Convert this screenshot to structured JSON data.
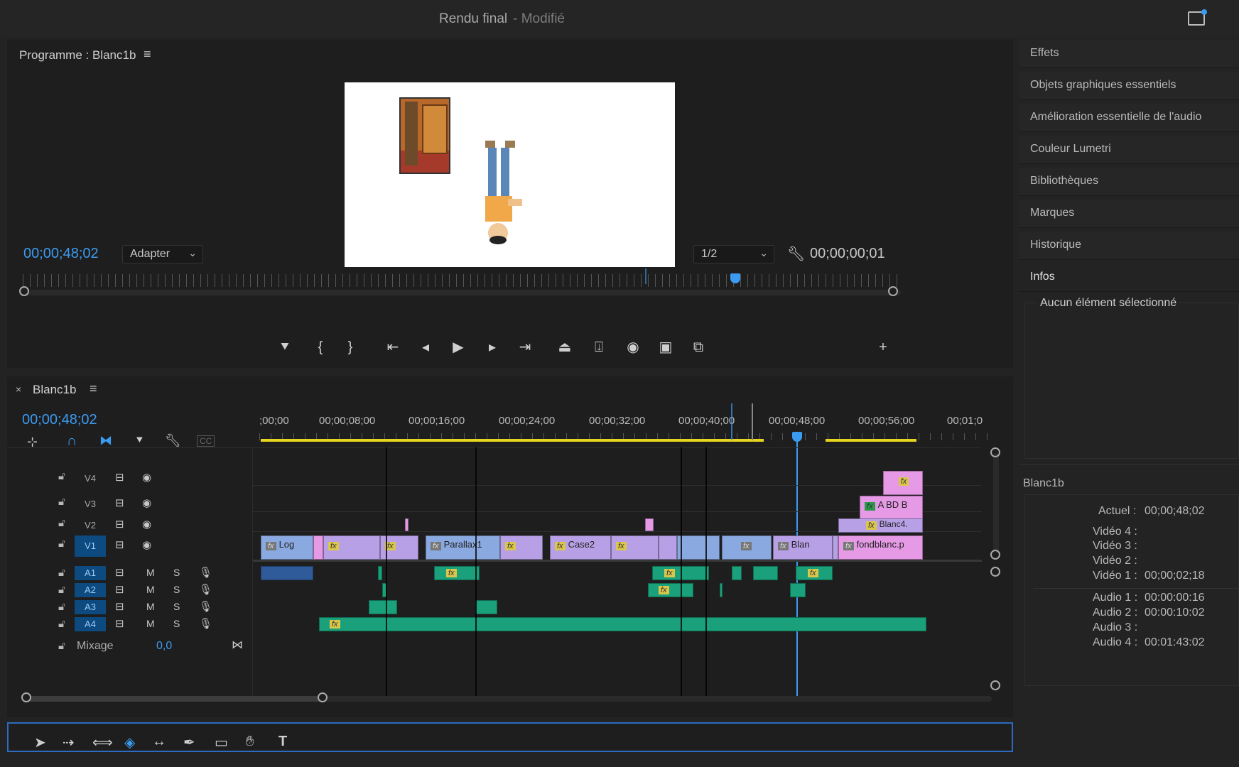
{
  "app": {
    "title": "Rendu final",
    "title_modified": "- Modifié"
  },
  "program": {
    "panel_title": "Programme : Blanc1b",
    "current_time": "00;00;48;02",
    "fit_select": "Adapter",
    "resolution_select": "1/2",
    "duration": "00;00;00;01"
  },
  "timeline": {
    "tab_label": "Blanc1b",
    "current_time": "00;00;48;02",
    "ruler": ";00;00,00;00;08;00,00;00;16;00,00;00;24;00,00;00;32;00,00;00;40;00,00;00;48;00,00;00;56;00,00;01;0",
    "ruler_ticks": [
      ";00;00",
      "00;00;08;00",
      "00;00;16;00",
      "00;00;24;00",
      "00;00;32;00",
      "00;00;40;00",
      "00;00;48;00",
      "00;00;56;00",
      "00;01;0"
    ],
    "tracks_video": [
      "V4",
      "V3",
      "V2",
      "V1"
    ],
    "tracks_audio": [
      "A1",
      "A2",
      "A3",
      "A4"
    ],
    "mute_label": "M",
    "solo_label": "S",
    "mix_label": "Mixage",
    "mix_value": "0,0",
    "clips": {
      "log": "Log",
      "parallax": "Parallax1",
      "case2": "Case2",
      "blan": "Blan",
      "fondblanc": "fondblanc.p",
      "abdb": "A BD B",
      "blanc4": "Blanc4."
    },
    "fx_label": "fx"
  },
  "right_panel": {
    "items": [
      "Effets",
      "Objets graphiques essentiels",
      "Amélioration essentielle de l'audio",
      "Couleur Lumetri",
      "Bibliothèques",
      "Marques",
      "Historique"
    ],
    "info_title": "Infos",
    "info_none": "Aucun élément sélectionné",
    "seq_name": "Blanc1b",
    "actual_label": "Actuel :",
    "actual_value": "00;00;48;02",
    "video4": "Vidéo 4 :",
    "video3": "Vidéo 3 :",
    "video2": "Vidéo 2 :",
    "video1": "Vidéo 1 :",
    "video1_value": "00;00;02;18",
    "audio1": "Audio 1 :",
    "audio1_value": "00:00:00:16",
    "audio2": "Audio 2 :",
    "audio2_value": "00:00:10:02",
    "audio3": "Audio 3 :",
    "audio4": "Audio 4 :",
    "audio4_value": "00:01:43:02"
  },
  "colors": {
    "accent_blue": "#3b9bf0",
    "clip_violet": "#b8a0e6",
    "clip_blue": "#8aa9e0",
    "clip_pink": "#e69ae6",
    "audio_green": "#1aa07a",
    "work_area_yellow": "#e6d41f"
  },
  "icons": [
    "workspace-icon",
    "hamburger-icon",
    "wrench-icon",
    "marker-icon",
    "mark-in-icon",
    "mark-out-icon",
    "go-to-in-icon",
    "step-back-icon",
    "play-icon",
    "step-forward-icon",
    "go-to-out-icon",
    "lift-icon",
    "extract-icon",
    "camera-icon",
    "compare-icon",
    "export-frame-icon",
    "plus-icon",
    "snap-icon",
    "linked-icon",
    "eye-icon",
    "lock-icon",
    "mic-icon",
    "selection-tool-icon",
    "track-select-icon",
    "ripple-edit-icon",
    "razor-icon",
    "slip-icon",
    "pen-icon",
    "rectangle-icon",
    "hand-icon",
    "type-icon"
  ]
}
